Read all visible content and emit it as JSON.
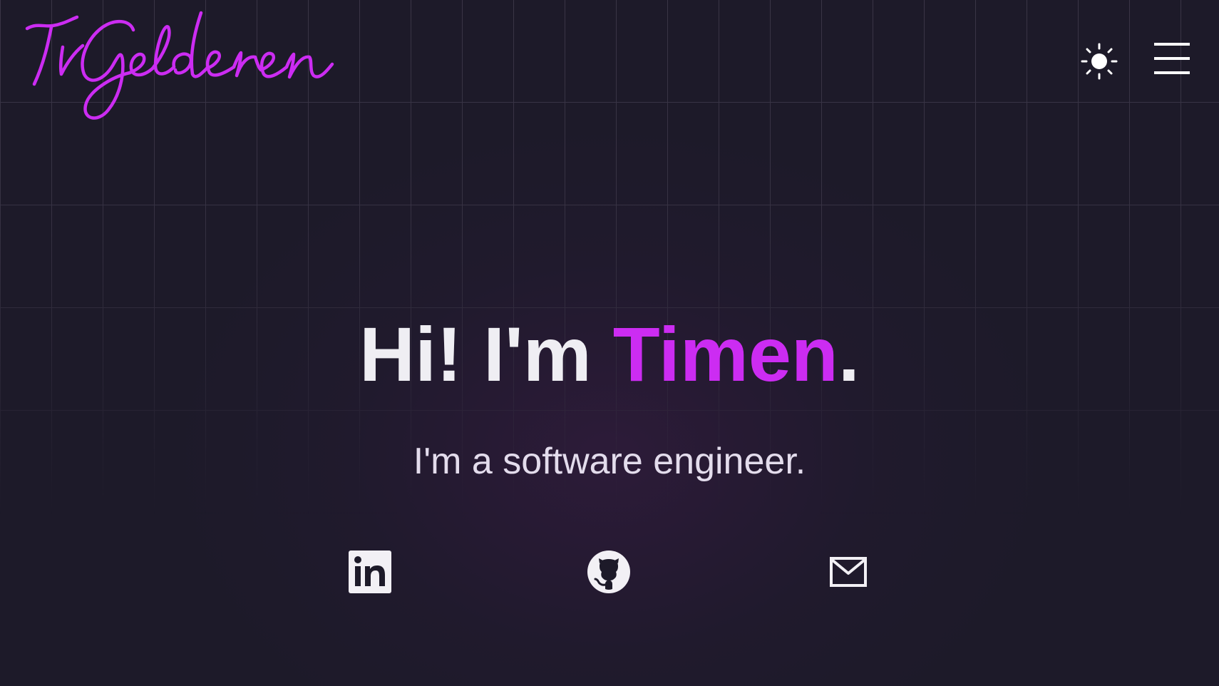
{
  "header": {
    "logo_text": "TvGelderen",
    "theme_toggle_icon": "sun-icon",
    "menu_icon": "hamburger-menu-icon"
  },
  "hero": {
    "greeting": "Hi! I'm",
    "name": "Timen",
    "punctuation": ".",
    "subtitle": "I'm a software engineer."
  },
  "social_links": [
    {
      "icon": "linkedin-icon"
    },
    {
      "icon": "github-icon"
    },
    {
      "icon": "email-icon"
    }
  ],
  "colors": {
    "background": "#1d1a29",
    "accent": "#cc2cf2",
    "text": "#efeef3",
    "subtext": "#e3dcec"
  }
}
